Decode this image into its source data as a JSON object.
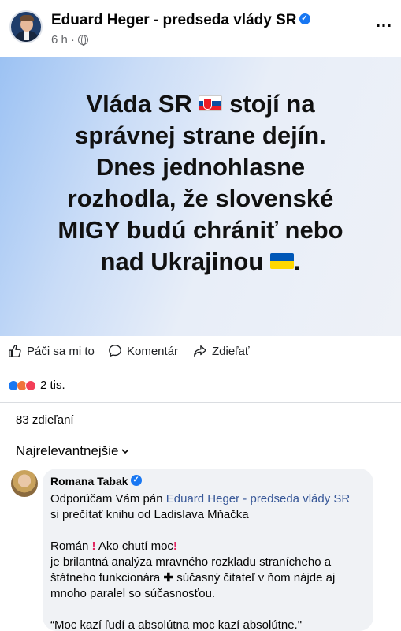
{
  "post": {
    "author": "Eduard Heger - predseda vlády SR",
    "time": "6 h",
    "separator": "·",
    "more_icon": "…",
    "banner_lines": {
      "l1a": "Vláda SR",
      "l1b": "stojí na",
      "l2": "správnej strane dejín.",
      "l3": "Dnes jednohlasne",
      "l4": "rozhodla, že slovenské",
      "l5": "MIGY budú chrániť nebo",
      "l6a": "nad Ukrajinou",
      "l6b": "."
    }
  },
  "actions": {
    "like": "Páči sa mi to",
    "comment": "Komentár",
    "share": "Zdieľať"
  },
  "reactions": {
    "count": "2 tis."
  },
  "shares": "83 zdieľaní",
  "sort_label": "Najrelevantnejšie",
  "comment": {
    "author": "Romana Tabak",
    "p1a": "Odporúčam Vám pán",
    "p1_link": "Eduard Heger - predseda vlády SR",
    "p1b": "si prečítať knihu od Ladislava Mňačka",
    "p2a": "Román",
    "p2b": "Ako chutí moc",
    "p2c": "je brilantná analýza mravného rozkladu stranícheho a",
    "p2d_a": "štátneho funkcionára",
    "p2d_b": "súčasný čitateľ v ňom nájde aj",
    "p2e": "mnoho paralel so súčasnosťou.",
    "p3": "“Moc kazí ľudí a absolútna moc kazí absolútne.\""
  }
}
